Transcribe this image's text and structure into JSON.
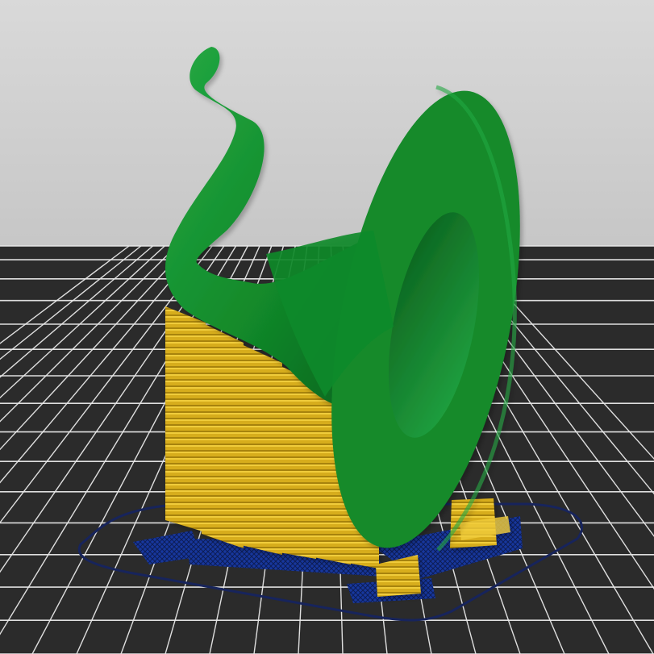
{
  "viewport": {
    "background_top": "#d9d9d9",
    "background_bottom": "#a8a8a8"
  },
  "bed": {
    "surface": "#2b2b2b",
    "grid_line": "#e9e9e9",
    "skirt": "#17245c"
  },
  "model": {
    "color": "#128a2a",
    "highlight": "#23a843",
    "shadow": "#0b5f1d"
  },
  "support": {
    "color": "#d7ad1b",
    "dark": "#a7830f",
    "light": "#f0cc3b"
  },
  "brim": {
    "color": "#17379d",
    "dark": "#0d1d56"
  }
}
